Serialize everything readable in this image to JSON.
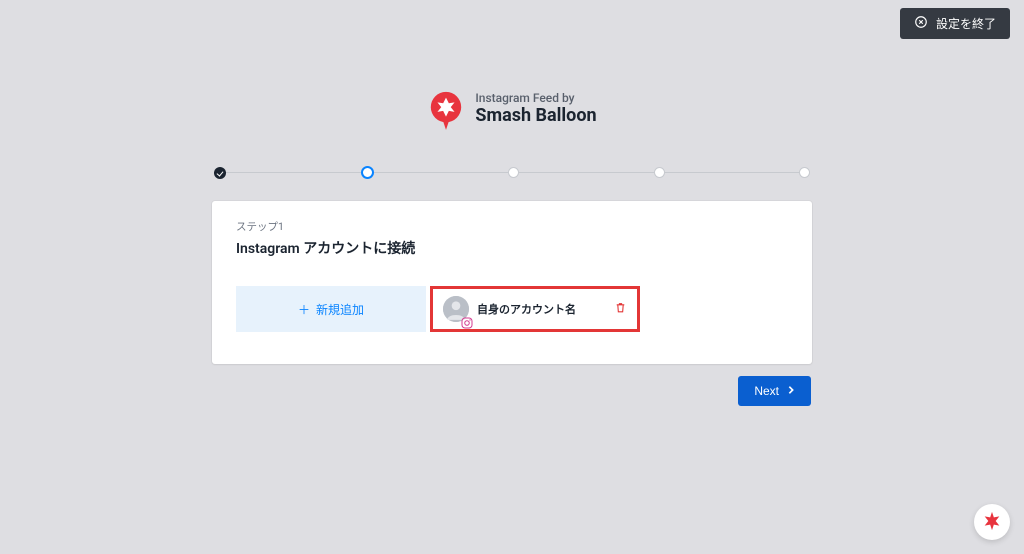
{
  "header": {
    "exit_label": "設定を終了"
  },
  "brand": {
    "small": "Instagram Feed by",
    "big": "Smash Balloon"
  },
  "stepper": {
    "steps": [
      {
        "state": "done"
      },
      {
        "state": "current"
      },
      {
        "state": "pending"
      },
      {
        "state": "pending"
      },
      {
        "state": "pending"
      }
    ]
  },
  "card": {
    "step_label": "ステップ1",
    "step_title": "Instagram アカウントに接続",
    "add_label": "新規追加",
    "account_name": "自身のアカウント名"
  },
  "nav": {
    "next_label": "Next"
  }
}
